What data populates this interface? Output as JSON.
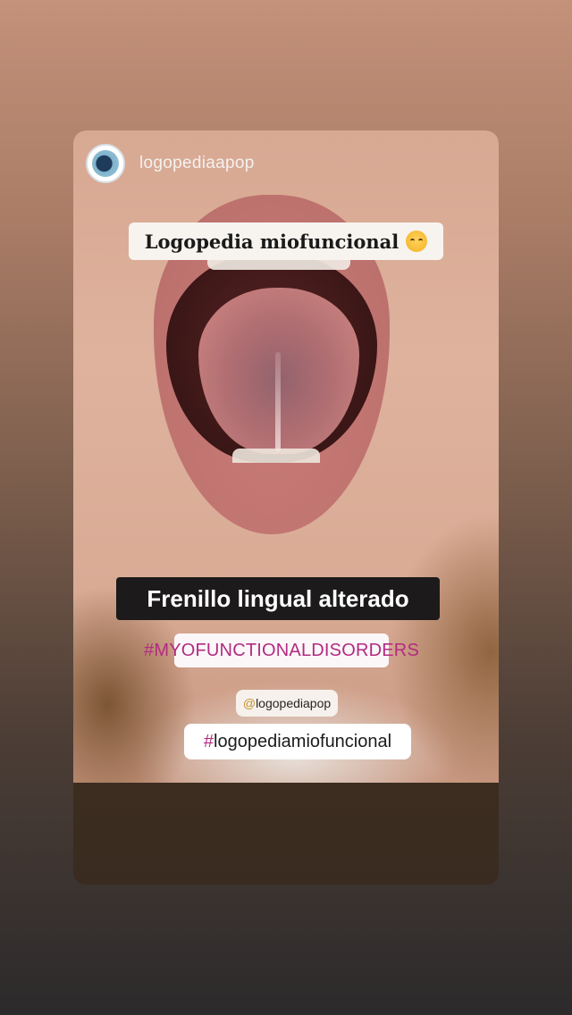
{
  "story": {
    "username": "logopediaapop",
    "avatar_icon": "logo-avatar",
    "stickers": {
      "title": "Logopedia miofuncional",
      "title_emoji": "partying-face-emoji",
      "subtitle": "Frenillo lingual alterado",
      "hashtag_caps": "MYOFUNCTIONALDISORDERS",
      "mention": "logopediapop",
      "hashtag": "logopediamiofuncional"
    }
  },
  "colors": {
    "hashtag": "#b32b82",
    "mention_at": "#c8902c",
    "subtitle_bg": "#1c1a1b"
  }
}
